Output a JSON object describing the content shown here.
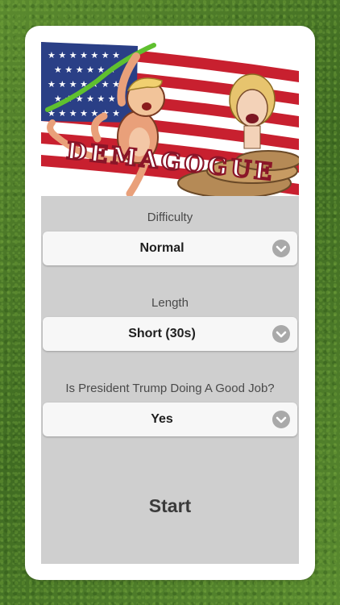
{
  "banner": {
    "title": "DEMAGOGUE"
  },
  "form": {
    "difficulty": {
      "label": "Difficulty",
      "value": "Normal"
    },
    "length": {
      "label": "Length",
      "value": "Short (30s)"
    },
    "question": {
      "label": "Is President Trump Doing A Good Job?",
      "value": "Yes"
    }
  },
  "start_label": "Start",
  "colors": {
    "grass": "#4f7a29",
    "card": "#ffffff",
    "panel": "#cfcfcf",
    "select_bg": "#f7f7f7",
    "chevron": "#a9a9a9",
    "flag_red": "#c8202f",
    "flag_blue": "#2a3f86"
  }
}
